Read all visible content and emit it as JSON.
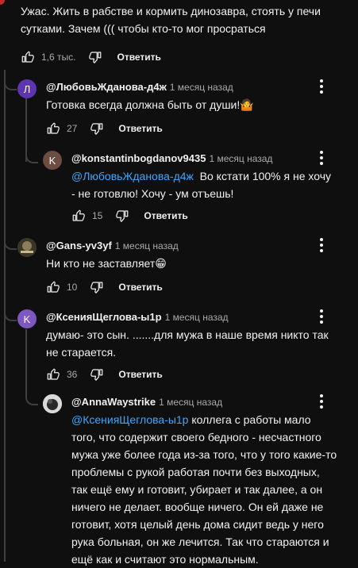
{
  "colors": {
    "background": "#0f0f0f",
    "link": "#3ea6ff",
    "text": "#f1f1f1",
    "secondary": "#aaaaaa"
  },
  "top_comment": {
    "text_line1": "Ужас.  Жить в рабстве и кормить динозавра, стоять у печи",
    "text_line2": "сутками. Зачем ((( чтобы кто-то мог просраться",
    "likes": "1,6 тыс.",
    "reply_label": "Ответить"
  },
  "comments": [
    {
      "avatar_letter": "Л",
      "author": "@ЛюбовьЖданова-д4ж",
      "time": "1 месяц назад",
      "text": "Готовка всегда должна быть от души!🤷",
      "likes": "27",
      "reply_label": "Ответить"
    },
    {
      "avatar_letter": "K",
      "author": "@konstantinbogdanov9435",
      "time": "1 месяц назад",
      "mention": "@ЛюбовьЖданова-д4ж",
      "text_line1_rest": "Во кстати 100% я не хочу",
      "text_line2": "- не готовлю! Хочу - ум отъешь!",
      "likes": "15",
      "reply_label": "Ответить"
    },
    {
      "author": "@Gans-yv3yf",
      "time": "1 месяц назад",
      "text": "Ни кто не заставляет😁",
      "likes": "10",
      "reply_label": "Ответить"
    },
    {
      "avatar_letter": "K",
      "author": "@КсенияЩеглова-ы1р",
      "time": "1 месяц назад",
      "text_line1": "думаю- это сын.  .......для мужа в наше время никто так",
      "text_line2": "не старается.",
      "likes": "36",
      "reply_label": "Ответить"
    },
    {
      "author": "@AnnaWaystrike",
      "time": "1 месяц назад",
      "mention": "@КсенияЩеглова-ы1р",
      "line1_rest": "коллега с работы мало",
      "lines": [
        "того, что содержит своего бедного - несчастного",
        "мужа уже более года из-за того, что у того какие-то",
        "проблемы с рукой работая почти без выходных,",
        "так ещё ему и готовит, убирает и так далее, а он",
        "ничего не делает. вообще ничего. Он ей даже не",
        "готовит, хотя целый день дома сидит ведь у него",
        "рука больная, он же лечится. Так что стараются и",
        "ещё как и считают это нормальным."
      ]
    }
  ]
}
